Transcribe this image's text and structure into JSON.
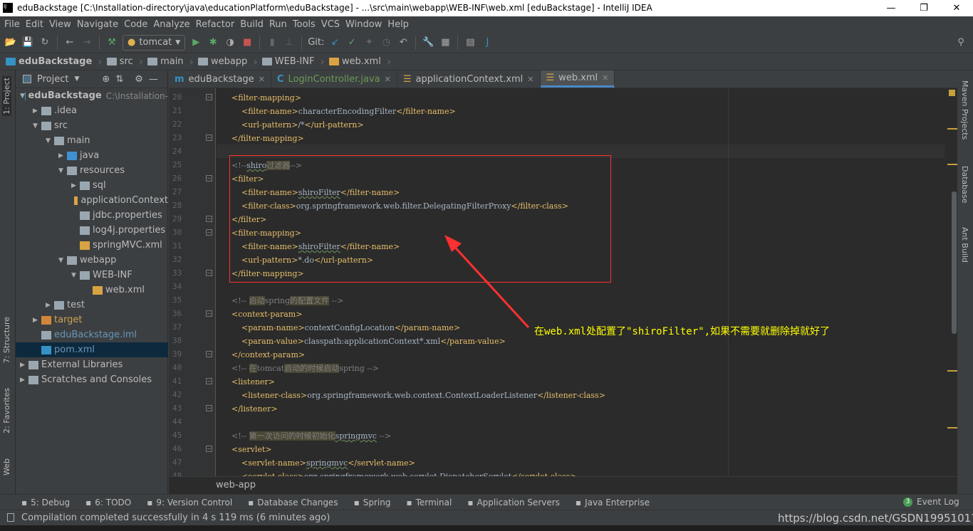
{
  "window": {
    "title": "eduBackstage [C:\\Installation-directory\\java\\educationPlatform\\eduBackstage] - ...\\src\\main\\webapp\\WEB-INF\\web.xml [eduBackstage] - IntelliJ IDEA",
    "logo": "IJ",
    "minimize": "—",
    "maximize": "❐",
    "close": "✕"
  },
  "menu": [
    "File",
    "Edit",
    "View",
    "Navigate",
    "Code",
    "Analyze",
    "Refactor",
    "Build",
    "Run",
    "Tools",
    "VCS",
    "Window",
    "Help"
  ],
  "toolbar": {
    "run_config": "tomcat",
    "git_label": "Git:"
  },
  "nav": [
    "eduBackstage",
    "src",
    "main",
    "webapp",
    "WEB-INF",
    "web.xml"
  ],
  "left_stripe": [
    "1: Project",
    "7: Structure",
    "2: Favorites",
    "Web"
  ],
  "right_stripe": [
    "Maven Projects",
    "Database",
    "Ant Build"
  ],
  "project": {
    "title": "Project",
    "tree": [
      {
        "label": "eduBackstage",
        "hint": "C:\\Installation-",
        "level": 0,
        "arrow": "down",
        "icon": "module",
        "bold": true
      },
      {
        "label": ".idea",
        "level": 1,
        "arrow": "right",
        "icon": "folder"
      },
      {
        "label": "src",
        "level": 1,
        "arrow": "down",
        "icon": "folder"
      },
      {
        "label": "main",
        "level": 2,
        "arrow": "down",
        "icon": "folder"
      },
      {
        "label": "java",
        "level": 3,
        "arrow": "right",
        "icon": "folder-blue"
      },
      {
        "label": "resources",
        "level": 3,
        "arrow": "down",
        "icon": "folder-res"
      },
      {
        "label": "sql",
        "level": 4,
        "arrow": "right",
        "icon": "folder"
      },
      {
        "label": "applicationContext",
        "level": 4,
        "icon": "xml"
      },
      {
        "label": "jdbc.properties",
        "level": 4,
        "icon": "props"
      },
      {
        "label": "log4j.properties",
        "level": 4,
        "icon": "props"
      },
      {
        "label": "springMVC.xml",
        "level": 4,
        "icon": "xml"
      },
      {
        "label": "webapp",
        "level": 3,
        "arrow": "down",
        "icon": "folder"
      },
      {
        "label": "WEB-INF",
        "level": 4,
        "arrow": "down",
        "icon": "folder"
      },
      {
        "label": "web.xml",
        "level": 5,
        "icon": "xml"
      },
      {
        "label": "test",
        "level": 2,
        "arrow": "right",
        "icon": "folder"
      },
      {
        "label": "target",
        "level": 1,
        "arrow": "right",
        "icon": "folder-orange",
        "color": "#d0a050"
      },
      {
        "label": "eduBackstage.iml",
        "level": 1,
        "icon": "iml",
        "color": "#6897bb"
      },
      {
        "label": "pom.xml",
        "level": 1,
        "icon": "maven",
        "color": "#6897bb",
        "selected": true
      },
      {
        "label": "External Libraries",
        "level": 0,
        "arrow": "right",
        "icon": "libs"
      },
      {
        "label": "Scratches and Consoles",
        "level": 0,
        "arrow": "right",
        "icon": "scratch"
      }
    ]
  },
  "tabs": [
    {
      "label": "eduBackstage",
      "icon": "m"
    },
    {
      "label": "LoginController.java",
      "icon": "c"
    },
    {
      "label": "applicationContext.xml",
      "icon": "xml"
    },
    {
      "label": "web.xml",
      "icon": "xml",
      "active": true
    }
  ],
  "code": {
    "start": 20,
    "lines": [
      [
        [
          "t",
          "<filter-mapping>"
        ]
      ],
      [
        [
          "x",
          "    "
        ],
        [
          "t",
          "<filter-name>"
        ],
        [
          "x",
          "characterEncodingFilter"
        ],
        [
          "t",
          "</filter-name>"
        ]
      ],
      [
        [
          "x",
          "    "
        ],
        [
          "t",
          "<url-pattern>"
        ],
        [
          "x",
          "/*"
        ],
        [
          "t",
          "</url-pattern>"
        ]
      ],
      [
        [
          "t",
          "</filter-mapping>"
        ]
      ],
      [],
      [
        [
          "c",
          "<!--"
        ],
        [
          "w",
          "shiro"
        ],
        [
          "h",
          "过滤器"
        ],
        [
          "c",
          "-->"
        ]
      ],
      [
        [
          "t",
          "<filter>"
        ]
      ],
      [
        [
          "x",
          "    "
        ],
        [
          "t",
          "<filter-name>"
        ],
        [
          "w",
          "shiroFilter"
        ],
        [
          "t",
          "</filter-name>"
        ]
      ],
      [
        [
          "x",
          "    "
        ],
        [
          "t",
          "<filter-class>"
        ],
        [
          "x",
          "org.springframework.web.filter.DelegatingFilterProxy"
        ],
        [
          "t",
          "</filter-class>"
        ]
      ],
      [
        [
          "t",
          "</filter>"
        ]
      ],
      [
        [
          "t",
          "<filter-mapping>"
        ]
      ],
      [
        [
          "x",
          "    "
        ],
        [
          "t",
          "<filter-name>"
        ],
        [
          "w",
          "shiroFilter"
        ],
        [
          "t",
          "</filter-name>"
        ]
      ],
      [
        [
          "x",
          "    "
        ],
        [
          "t",
          "<url-pattern>"
        ],
        [
          "x",
          "*.do"
        ],
        [
          "t",
          "</url-pattern>"
        ]
      ],
      [
        [
          "t",
          "</filter-mapping>"
        ]
      ],
      [],
      [
        [
          "c",
          "<!-- "
        ],
        [
          "h",
          "启动"
        ],
        [
          "c",
          "spring"
        ],
        [
          "h",
          "的配置文件"
        ],
        [
          "c",
          " -->"
        ]
      ],
      [
        [
          "t",
          "<context-param>"
        ]
      ],
      [
        [
          "x",
          "    "
        ],
        [
          "t",
          "<param-name>"
        ],
        [
          "x",
          "contextConfigLocation"
        ],
        [
          "t",
          "</param-name>"
        ]
      ],
      [
        [
          "x",
          "    "
        ],
        [
          "t",
          "<param-value>"
        ],
        [
          "x",
          "classpath:applicationContext*.xml"
        ],
        [
          "t",
          "</param-value>"
        ]
      ],
      [
        [
          "t",
          "</context-param>"
        ]
      ],
      [
        [
          "c",
          "<!-- "
        ],
        [
          "h",
          "在"
        ],
        [
          "c",
          "tomcat"
        ],
        [
          "h",
          "启动的时候启动"
        ],
        [
          "c",
          "spring -->"
        ]
      ],
      [
        [
          "t",
          "<listener>"
        ]
      ],
      [
        [
          "x",
          "    "
        ],
        [
          "t",
          "<listener-class>"
        ],
        [
          "x",
          "org.springframework.web.context.ContextLoaderListener"
        ],
        [
          "t",
          "</listener-class>"
        ]
      ],
      [
        [
          "t",
          "</listener>"
        ]
      ],
      [],
      [
        [
          "c",
          "<!-- "
        ],
        [
          "h",
          "第一次访问的时候初始化"
        ],
        [
          "w",
          "springmvc"
        ],
        [
          "c",
          " -->"
        ]
      ],
      [
        [
          "t",
          "<servlet>"
        ]
      ],
      [
        [
          "x",
          "    "
        ],
        [
          "t",
          "<servlet-name>"
        ],
        [
          "w",
          "springmvc"
        ],
        [
          "t",
          "</servlet-name>"
        ]
      ],
      [
        [
          "x",
          "    "
        ],
        [
          "t",
          "<servlet-class>"
        ],
        [
          "x",
          "org.springframework.web.servlet.DispatcherServlet"
        ],
        [
          "t",
          "</servlet-class>"
        ]
      ]
    ]
  },
  "annotation": "在web.xml处配置了\"shiroFilter\",如果不需要就删除掉就好了",
  "editor_breadcrumb": "web-app",
  "tool_windows": [
    "5: Debug",
    "6: TODO",
    "9: Version Control",
    "Database Changes",
    "Spring",
    "Terminal",
    "Application Servers",
    "Java Enterprise"
  ],
  "event_log": "Event Log",
  "event_count": "3",
  "status": "Compilation completed successfully in 4 s 119 ms (6 minutes ago)",
  "watermark": "https://blog.csdn.net/GSDN19951017",
  "colors": {
    "accent": "#4a88c7",
    "annotation": "#ffff00",
    "highlight_box": "#ff3030",
    "tag": "#e8bf6a"
  }
}
